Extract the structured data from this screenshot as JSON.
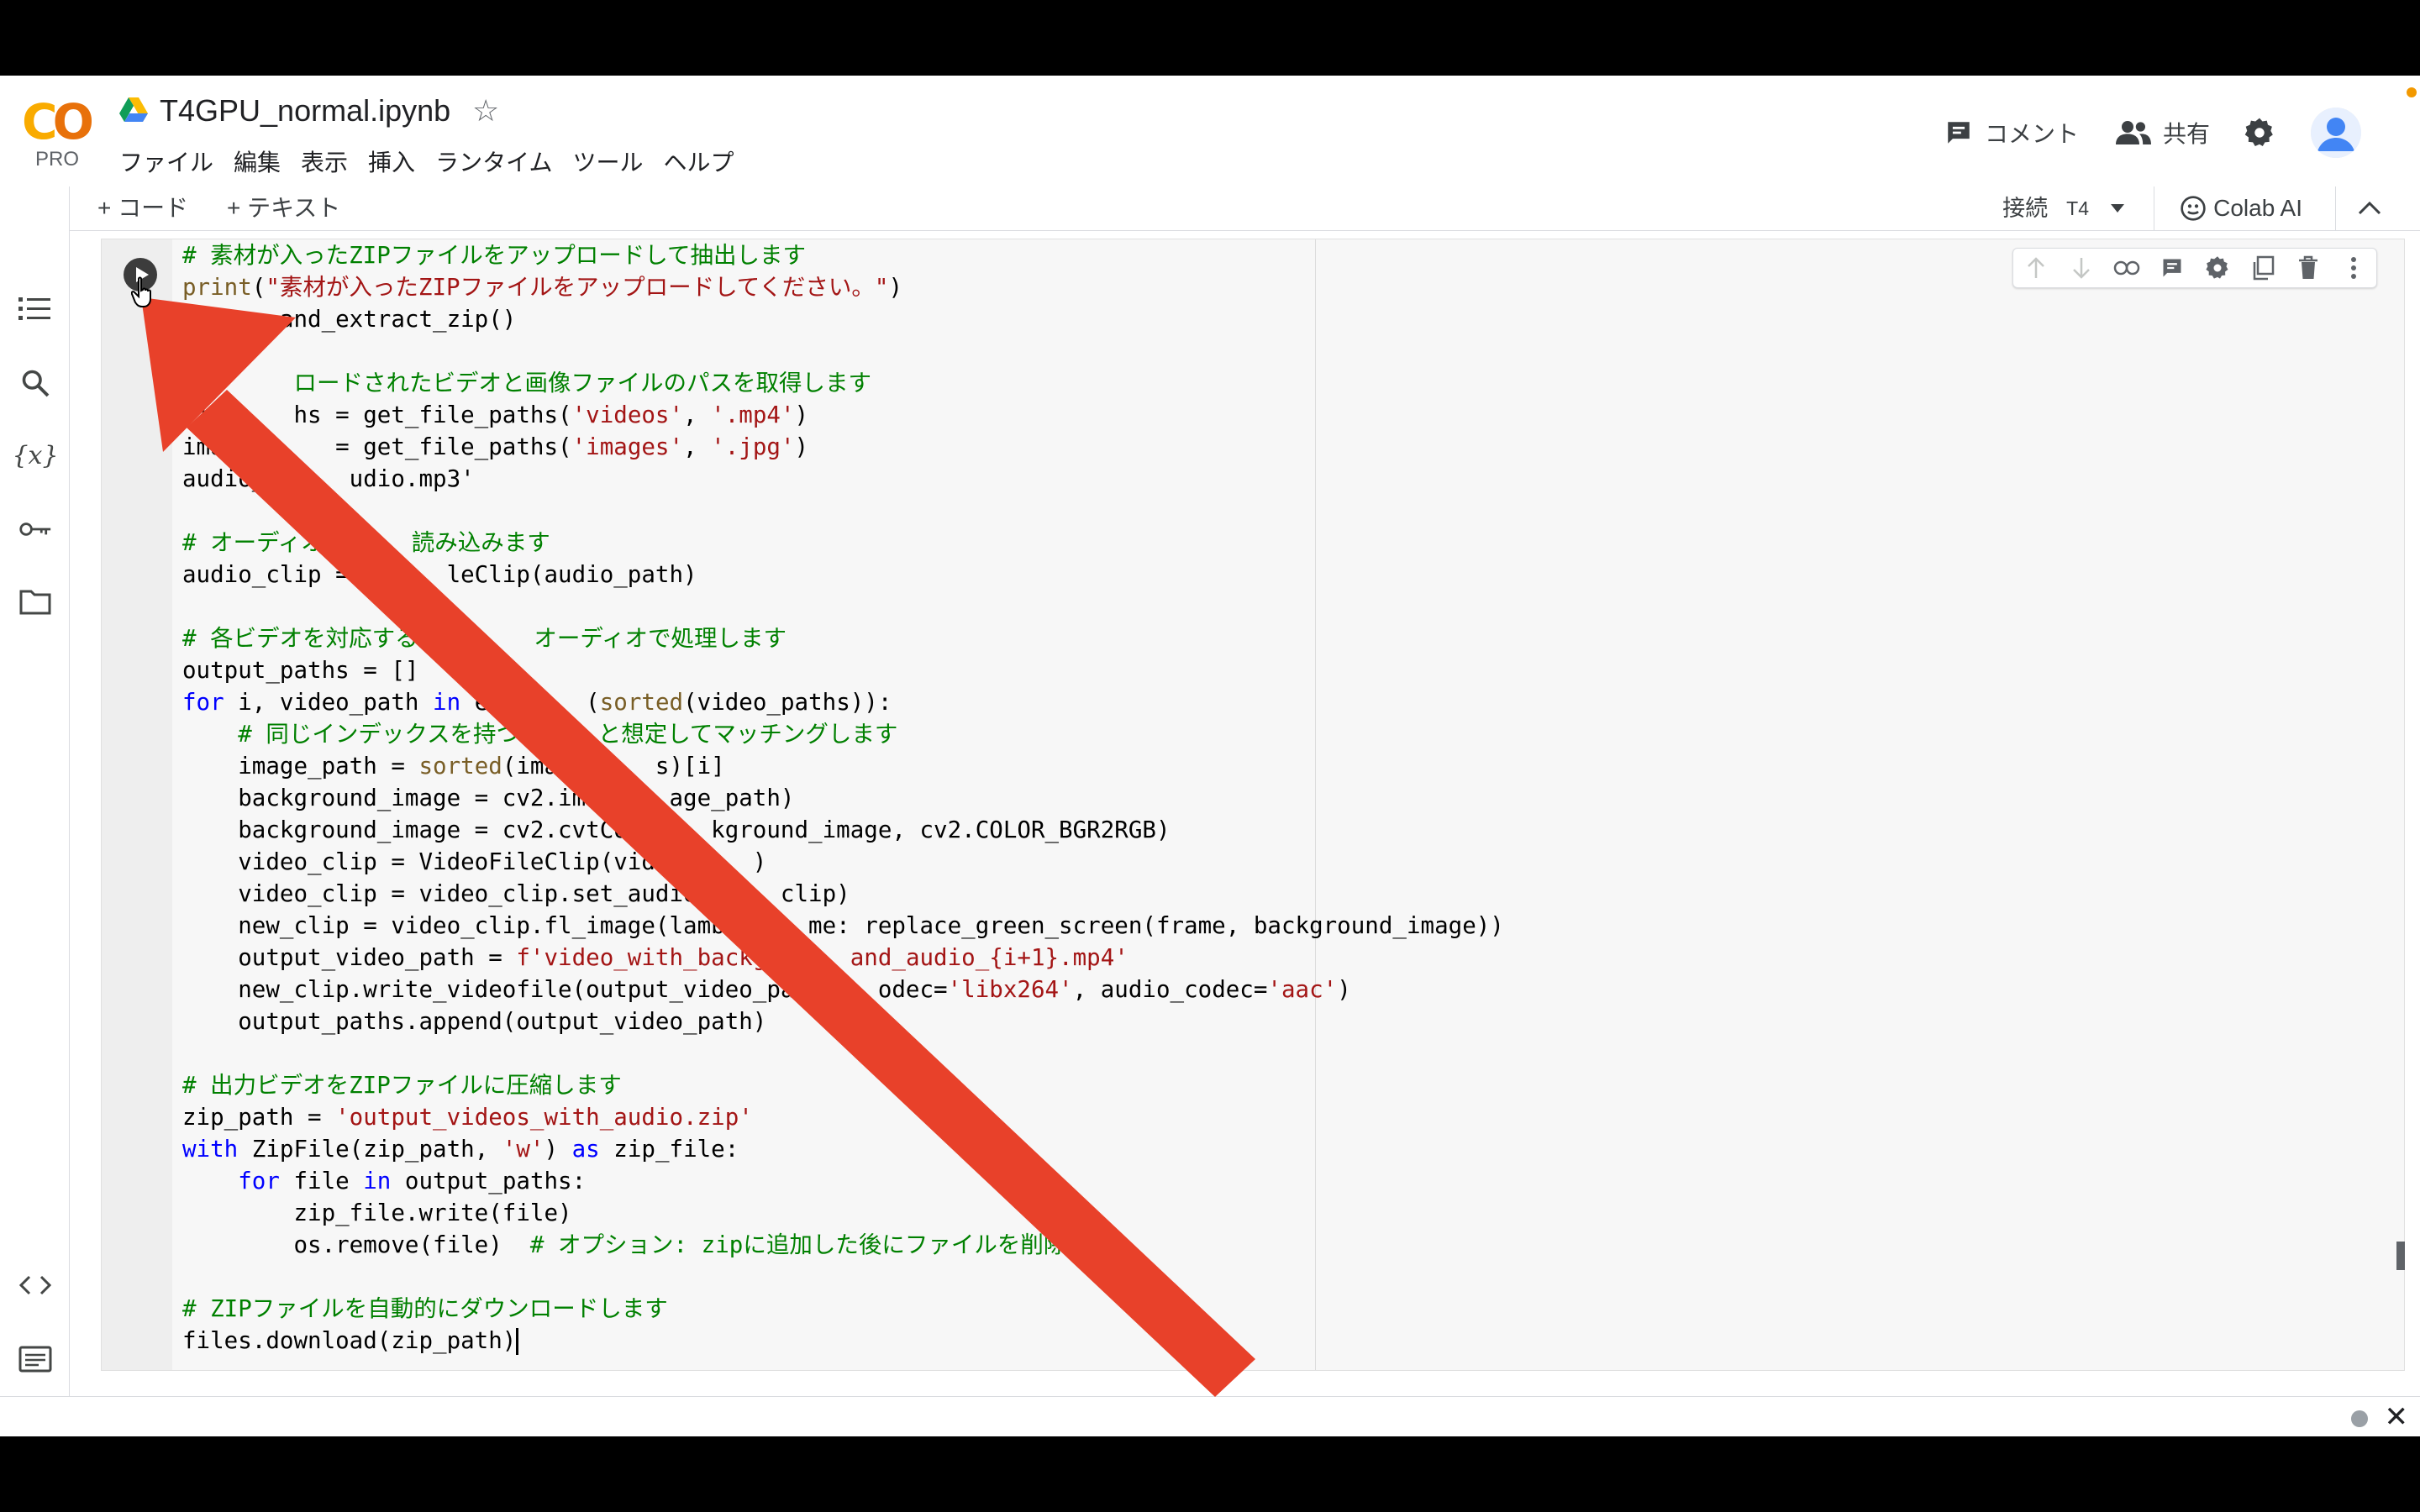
{
  "app": {
    "logo": {
      "text": "CO",
      "sub": "PRO"
    },
    "notebook_title": "T4GPU_normal.ipynb",
    "star_glyph": "☆",
    "menu": [
      "ファイル",
      "編集",
      "表示",
      "挿入",
      "ランタイム",
      "ツール",
      "ヘルプ"
    ],
    "comment_label": "コメント",
    "share_label": "共有",
    "toolbar": {
      "add_code": "+ コード",
      "add_text": "+ テキスト",
      "connect_label": "接続",
      "runtime_type": "T4",
      "colab_ai": "Colab AI"
    }
  },
  "icons": {
    "drive": "google-drive-icon",
    "comment": "comment-icon",
    "share": "people-icon",
    "settings": "gear-icon",
    "sidebar": [
      "toc-icon",
      "search-icon",
      "variables-icon",
      "key-icon",
      "folder-icon",
      "code-snippets-icon",
      "command-palette-icon",
      "terminal-icon"
    ],
    "cell_toolbar": [
      "arrow-up-icon",
      "arrow-down-icon",
      "link-icon",
      "comment-icon",
      "gear-icon",
      "mirror-cell-icon",
      "trash-icon",
      "more-vert-icon"
    ]
  },
  "code_lines": [
    "# 素材が入ったZIPファイルをアップロードして抽出します",
    "print(\"素材が入ったZIPファイルをアップロードしてください。\")",
    "      _and_extract_zip()",
    "",
    "#       ロードされたビデオと画像ファイルのパスを取得します",
    "vide    hs = get_file_paths('videos', '.mp4')",
    "image_p    = get_file_paths('images', '.jpg')",
    "audio_pat   udio.mp3'",
    "",
    "# オーディオクリ   読み込みます",
    "audio_clip = Au    leClip(audio_path)",
    "",
    "# 各ビデオを対応する背景     オーディオで処理します",
    "output_paths = []",
    "for i, video_path in enu     (sorted(video_paths)):",
    "    # 同じインデックスを持つ画    と想定してマッチングします",
    "    image_path = sorted(image     s)[i]",
    "    background_image = cv2.imre    age_path)",
    "    background_image = cv2.cvtCol     kground_image, cv2.COLOR_BGR2RGB)",
    "    video_clip = VideoFileClip(video     )",
    "    video_clip = video_clip.set_audio(     clip)",
    "    new_clip = video_clip.fl_image(lambd     me: replace_green_screen(frame, background_image))",
    "    output_video_path = f'video_with_backg      and_audio_{i+1}.mp4'",
    "    new_clip.write_videofile(output_video_pa      odec='libx264', audio_codec='aac')",
    "    output_paths.append(output_video_path)",
    "",
    "# 出力ビデオをZIPファイルに圧縮します",
    "zip_path = 'output_videos_with_audio.zip'",
    "with ZipFile(zip_path, 'w') as zip_file:",
    "    for file in output_paths:",
    "        zip_file.write(file)",
    "        os.remove(file)  # オプション: zipに追加した後にファイルを削除     ",
    "",
    "# ZIPファイルを自動的にダウンロードします",
    "files.download(zip_path)"
  ],
  "colors": {
    "arrow": "#e8412a",
    "comment": "#008000",
    "keyword": "#0000ff",
    "string": "#a31515",
    "builtin": "#795e26",
    "logo_yellow": "#f9ab00",
    "logo_orange": "#e8710a"
  }
}
